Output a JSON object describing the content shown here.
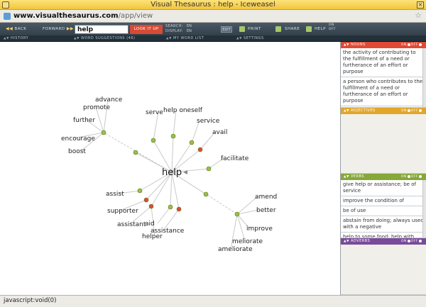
{
  "window": {
    "title": "Visual Thesaurus : help - Iceweasel"
  },
  "urlbar": {
    "domain": "www.visualthesaurus.com",
    "path": "/app/view"
  },
  "toolbar": {
    "back": "BACK",
    "forward": "FORWARD",
    "search_value": "help",
    "lookup": "LOOK IT UP",
    "search_label": "SEARCH:",
    "search_lang": "EN",
    "display_label": "DISPLAY:",
    "display_lang": "EN",
    "edit": "EDIT",
    "print": "PRINT",
    "share": "SHARE",
    "help": "HELP",
    "on": "ON",
    "off": "OFF"
  },
  "tabs": {
    "history": "HISTORY",
    "word_suggestions": "WORD SUGGESTIONS (46)",
    "word_list": "MY WORD LIST",
    "settings": "SETTINGS"
  },
  "graph": {
    "center": "help",
    "words": [
      "advance",
      "promote",
      "further",
      "encourage",
      "boost",
      "serve",
      "help oneself",
      "service",
      "avail",
      "facilitate",
      "assist",
      "supporter",
      "assistant",
      "aid",
      "assistance",
      "helper",
      "amend",
      "better",
      "improve",
      "meliorate",
      "ameliorate"
    ]
  },
  "panel": {
    "on": "ON",
    "off": "OFF",
    "nouns": {
      "title": "NOUNS",
      "color": "#e04a35",
      "defs": [
        "the activity of contributing to the fulfillment of a need or furtherance of an effort or purpose",
        "a person who contributes to the fulfillment of a need or furtherance of an effort or purpose"
      ]
    },
    "adjectives": {
      "title": "ADJECTIVES",
      "color": "#e2a62a"
    },
    "verbs": {
      "title": "VERBS",
      "color": "#86a83a",
      "defs": [
        "give help or assistance; be of service",
        "improve the condition of",
        "be of use",
        "abstain from doing; always used with a negative",
        "help to some food; help with"
      ]
    },
    "adverbs": {
      "title": "ADVERBS",
      "color": "#7a4b9b"
    }
  },
  "status": {
    "text": "javascript:void(0)"
  },
  "colors": {
    "node_green": "#9bbf45",
    "node_red": "#e04a35",
    "edge": "#c9c9c9"
  }
}
